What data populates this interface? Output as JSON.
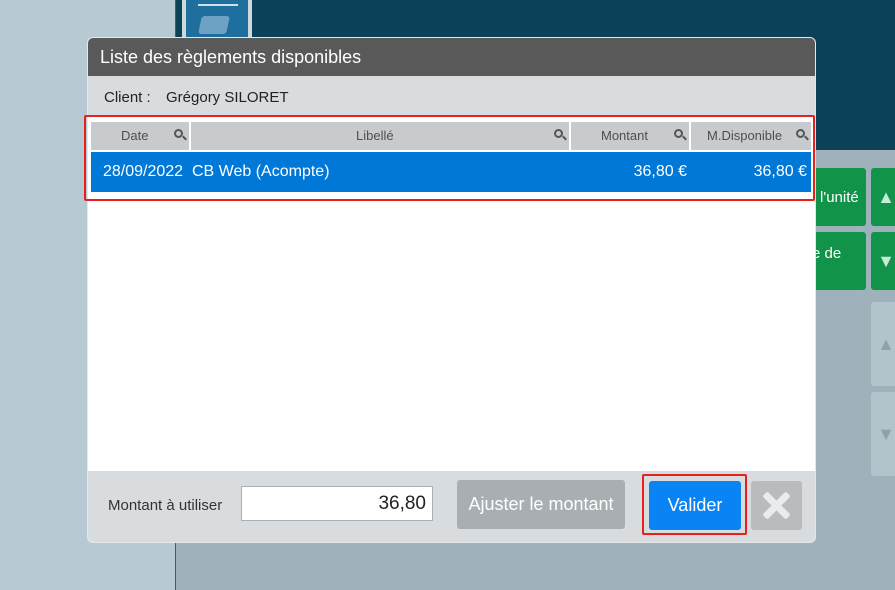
{
  "background": {
    "buttons": [
      {
        "label": "l'unité"
      },
      {
        "label": "e de"
      }
    ],
    "arrow_up": "▲",
    "arrow_down": "▼"
  },
  "dialog": {
    "title": "Liste des règlements disponibles",
    "client_label": "Client :",
    "client_name": "Grégory SILORET",
    "columns": [
      {
        "label": "Date"
      },
      {
        "label": "Libellé"
      },
      {
        "label": "Montant"
      },
      {
        "label": "M.Disponible"
      }
    ],
    "rows": [
      {
        "date": "28/09/2022",
        "libelle": "CB Web (Acompte)",
        "montant": "36,80 €",
        "disponible": "36,80 €",
        "selected": true
      }
    ],
    "footer": {
      "amount_label": "Montant à utiliser",
      "amount_value": "36,80",
      "adjust_label": "Ajuster le montant",
      "validate_label": "Valider"
    }
  },
  "colors": {
    "title_bar": "#595959",
    "selected_row": "#0078d7",
    "validate_button": "#0a84f5",
    "highlight": "#e8201d"
  }
}
